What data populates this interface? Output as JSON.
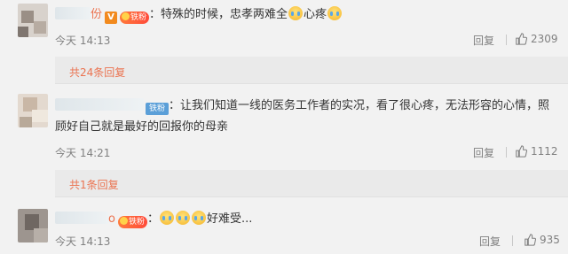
{
  "comments": [
    {
      "username": "份",
      "badge_v": "V",
      "fan_badge": "铁粉",
      "text": "：特殊的时候，忠孝两难全",
      "text_after": "心疼",
      "time": "今天 14:13",
      "reply_label": "回复",
      "likes": "2309",
      "more_replies": "共24条回复"
    },
    {
      "fan_badge": "铁粉",
      "text": "：让我们知道一线的医务工作者的实况，看了很心疼，无法形容的心情，照",
      "text_line2": "顾好自己就是最好的回报你的母亲",
      "time": "今天 14:21",
      "reply_label": "回复",
      "likes": "1112",
      "more_replies": "共1条回复"
    },
    {
      "username": "o",
      "fan_badge": "铁粉",
      "text": "：",
      "text_after": "好难受...",
      "time": "今天 14:13",
      "reply_label": "回复",
      "likes": "935"
    }
  ],
  "icons": {
    "thumb": "thumbs-up-icon",
    "emoji_crying": "crying-emoji-icon",
    "vip": "v-badge-icon"
  },
  "colors": {
    "accent": "#eb7350",
    "muted": "#808080",
    "background": "#f2f2f2"
  }
}
